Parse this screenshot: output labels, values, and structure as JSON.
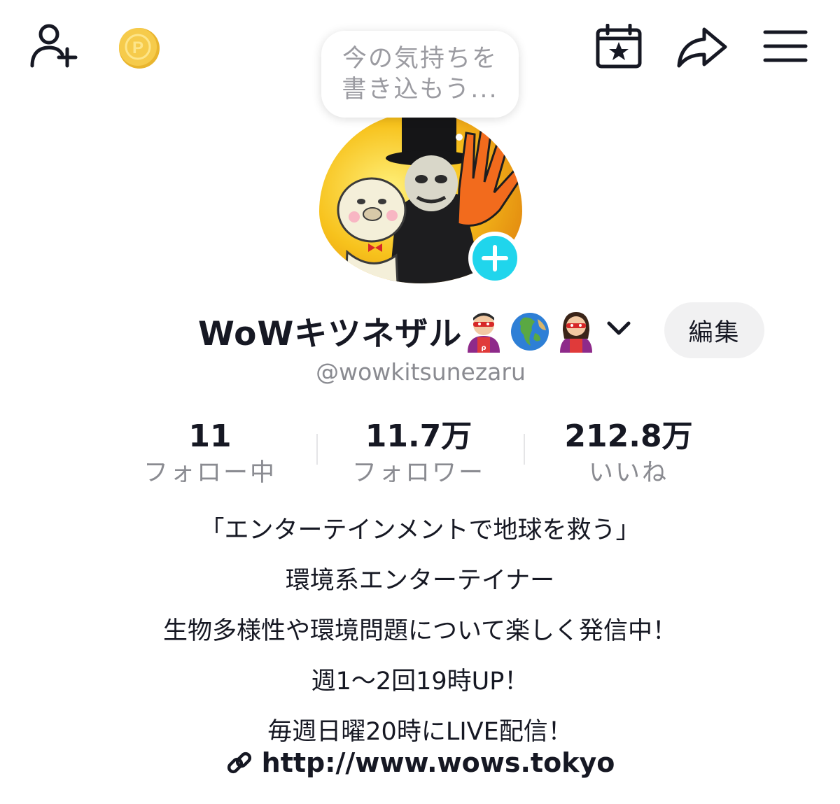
{
  "mood_placeholder": {
    "line1": "今の気持ちを",
    "line2": "書き込もう..."
  },
  "profile": {
    "display_name": "WoWキツネザル",
    "name_emojis": [
      "superhero-man-emoji",
      "globe-europe-africa-emoji",
      "superhero-woman-emoji"
    ],
    "username": "@wowkitsunezaru",
    "edit_label": "編集"
  },
  "stats": [
    {
      "value": "11",
      "label": "フォロー中"
    },
    {
      "value": "11.7万",
      "label": "フォロワー"
    },
    {
      "value": "212.8万",
      "label": "いいね"
    }
  ],
  "bio": {
    "lines": [
      "「エンターテインメントで地球を救う」",
      "環境系エンターテイナー",
      "生物多様性や環境問題について楽しく発信中！",
      "週1〜2回19時UP！",
      "毎週日曜20時にLIVE配信！"
    ],
    "link": "http://www.wows.tokyo"
  },
  "icons": {
    "top_left": [
      "add-friend-icon",
      "coin-icon"
    ],
    "top_right": [
      "calendar-star-icon",
      "share-icon",
      "menu-icon"
    ]
  },
  "colors": {
    "text": "#161823",
    "secondary_text": "#8a8b91",
    "plus_badge": "#20d5ec",
    "coin": "#f5c542",
    "edit_button_bg": "#f1f1f2"
  }
}
